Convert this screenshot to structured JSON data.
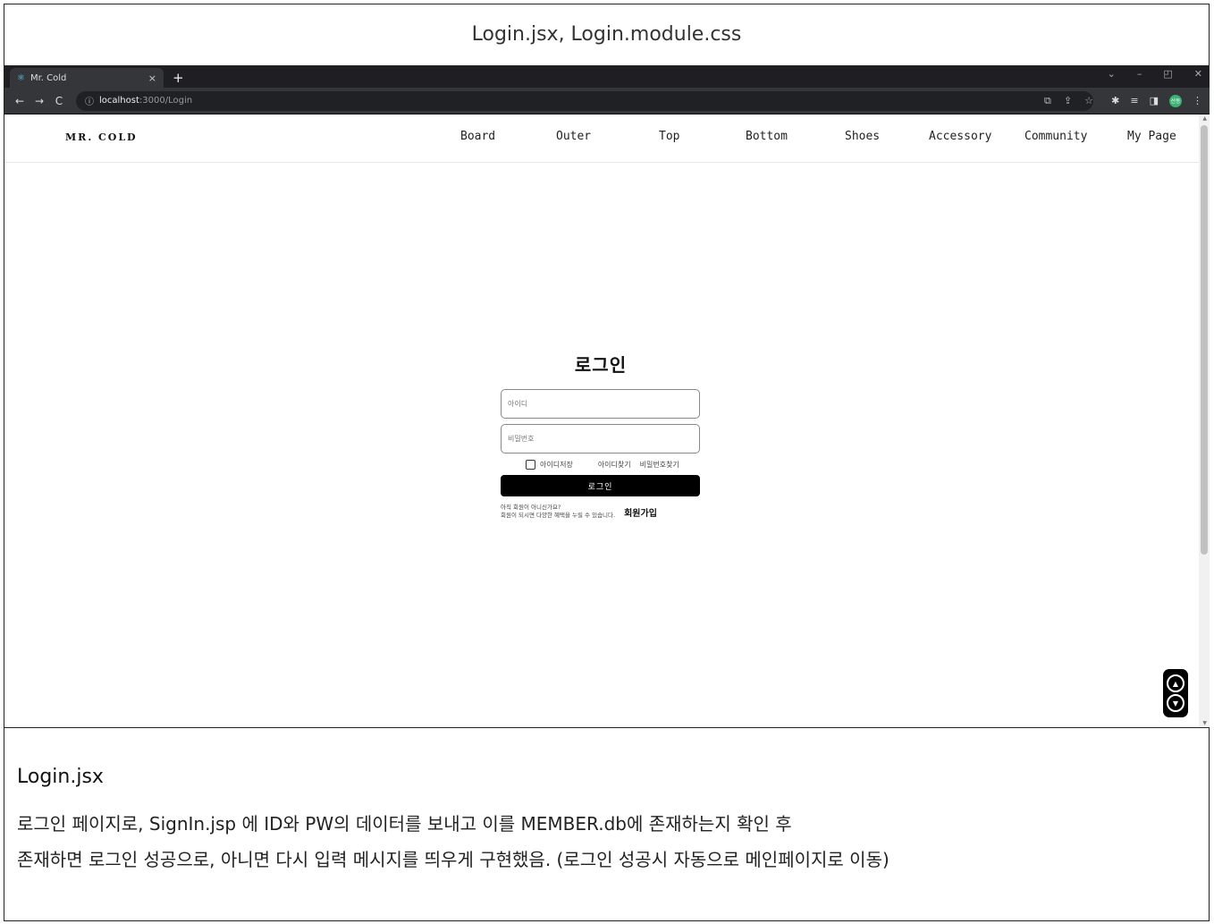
{
  "doc": {
    "header": "Login.jsx, Login.module.css",
    "notes_title": "Login.jsx",
    "notes_lines": [
      "로그인 페이지로, SignIn.jsp 에 ID와 PW의 데이터를 보내고 이를 MEMBER.db에 존재하는지 확인 후",
      "존재하면 로그인 성공으로, 아니면 다시 입력 메시지를 띄우게 구현했음. (로그인 성공시 자동으로 메인페이지로 이동)"
    ]
  },
  "browser": {
    "tab_title": "Mr. Cold",
    "tab_close": "×",
    "new_tab": "+",
    "url_host": "localhost",
    "url_path": ":3000/Login",
    "avatar_text": "선동"
  },
  "site": {
    "logo": "MR. COLD",
    "menu": [
      "Board",
      "Outer",
      "Top",
      "Bottom",
      "Shoes",
      "Accessory",
      "Community",
      "My Page"
    ]
  },
  "login": {
    "title": "로그인",
    "id_placeholder": "아이디",
    "pw_placeholder": "비밀번호",
    "remember_label": "아이디저장",
    "find_id": "아이디찾기",
    "find_pw": "비밀번호찾기",
    "submit": "로그인",
    "signup_line1": "아직 회원이 아니신가요?",
    "signup_line2": "회원이 되시면 다양한 혜택을 누릴 수 있습니다.",
    "signup_link": "회원가입"
  }
}
